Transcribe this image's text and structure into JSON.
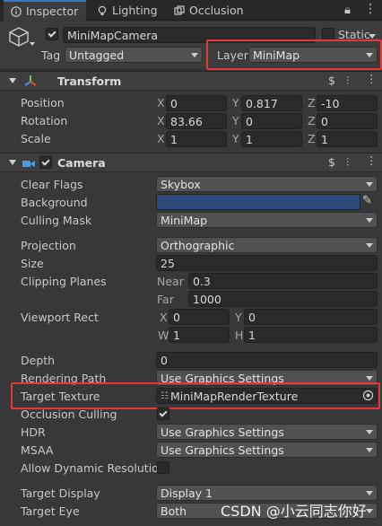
{
  "tabs": [
    {
      "label": "Inspector",
      "icon": "info-icon"
    },
    {
      "label": "Lighting",
      "icon": "bulb-icon"
    },
    {
      "label": "Occlusion",
      "icon": "occlusion-icon"
    }
  ],
  "object": {
    "name": "MiniMapCamera",
    "static_label": "Static",
    "tag_label": "Tag",
    "tag_value": "Untagged",
    "layer_label": "Layer",
    "layer_value": "MiniMap",
    "active": true
  },
  "transform": {
    "title": "Transform",
    "rows": [
      {
        "label": "Position",
        "x": "0",
        "y": "0.817",
        "z": "-10"
      },
      {
        "label": "Rotation",
        "x": "83.66",
        "y": "0",
        "z": "0"
      },
      {
        "label": "Scale",
        "x": "1",
        "y": "1",
        "z": "1"
      }
    ]
  },
  "camera": {
    "title": "Camera",
    "enabled": true,
    "clear_flags": {
      "label": "Clear Flags",
      "value": "Skybox"
    },
    "background": {
      "label": "Background",
      "color": "#2a4a7a"
    },
    "culling_mask": {
      "label": "Culling Mask",
      "value": "MiniMap"
    },
    "projection": {
      "label": "Projection",
      "value": "Orthographic"
    },
    "size": {
      "label": "Size",
      "value": "25"
    },
    "clipping": {
      "label": "Clipping Planes",
      "near_label": "Near",
      "near": "0.3",
      "far_label": "Far",
      "far": "1000"
    },
    "viewport": {
      "label": "Viewport Rect",
      "x": "0",
      "y": "0",
      "w": "1",
      "h": "1"
    },
    "depth": {
      "label": "Depth",
      "value": "0"
    },
    "rendering_path": {
      "label": "Rendering Path",
      "value": "Use Graphics Settings"
    },
    "target_texture": {
      "label": "Target Texture",
      "value": "MiniMapRenderTexture"
    },
    "occlusion_culling": {
      "label": "Occlusion Culling",
      "checked": true
    },
    "hdr": {
      "label": "HDR",
      "value": "Use Graphics Settings"
    },
    "msaa": {
      "label": "MSAA",
      "value": "Use Graphics Settings"
    },
    "dynamic_res": {
      "label": "Allow Dynamic Resolution",
      "checked": false
    },
    "target_display": {
      "label": "Target Display",
      "value": "Display 1"
    },
    "target_eye": {
      "label": "Target Eye",
      "value": "Both"
    }
  },
  "watermark": "CSDN @小云同志你好",
  "colors": {
    "highlight": "#e53935",
    "accent": "#3a79bb"
  }
}
